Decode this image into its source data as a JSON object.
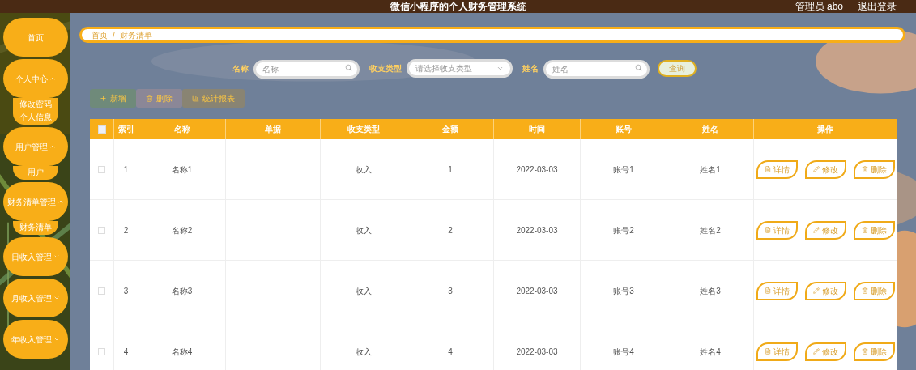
{
  "header": {
    "title": "微信小程序的个人财务管理系统",
    "user": "管理员 abo",
    "logout": "退出登录"
  },
  "sidebar": {
    "items": [
      {
        "label": "首页"
      },
      {
        "label": "个人中心",
        "expanded": true,
        "children": [
          {
            "label": "修改密码"
          },
          {
            "label": "个人信息"
          }
        ]
      },
      {
        "label": "用户管理",
        "expanded": true,
        "children": [
          {
            "label": "用户"
          }
        ]
      },
      {
        "label": "财务清单管理",
        "expanded": true,
        "children": [
          {
            "label": "财务清单"
          }
        ]
      },
      {
        "label": "日收入管理",
        "expanded": false
      },
      {
        "label": "月收入管理",
        "expanded": false
      },
      {
        "label": "年收入管理",
        "expanded": false
      }
    ]
  },
  "breadcrumb": [
    "首页",
    "/",
    "财务清单"
  ],
  "search": [
    {
      "kind": "text",
      "label": "名称",
      "placeholder": "名称"
    },
    {
      "kind": "select",
      "label": "收支类型",
      "placeholder": "请选择收支类型"
    },
    {
      "kind": "text",
      "label": "姓名",
      "placeholder": "姓名"
    }
  ],
  "search_button": "查询",
  "toolbar": [
    {
      "kind": "add",
      "label": "新增"
    },
    {
      "kind": "delete",
      "label": "删除"
    },
    {
      "kind": "report",
      "label": "统计报表"
    }
  ],
  "table": {
    "columns": [
      "索引",
      "名称",
      "单据",
      "收支类型",
      "金额",
      "时间",
      "账号",
      "姓名",
      "操作"
    ],
    "header_checked": false,
    "rows": [
      {
        "checked": false,
        "cells": [
          "1",
          "名称1",
          "",
          "收入",
          "1",
          "2022-03-03",
          "账号1",
          "姓名1"
        ],
        "actions": [
          {
            "kind": "detail",
            "label": "详情"
          },
          {
            "kind": "edit",
            "label": "修改"
          },
          {
            "kind": "delete",
            "label": "删除"
          }
        ]
      },
      {
        "checked": false,
        "cells": [
          "2",
          "名称2",
          "",
          "收入",
          "2",
          "2022-03-03",
          "账号2",
          "姓名2"
        ],
        "actions": [
          {
            "kind": "detail",
            "label": "详情"
          },
          {
            "kind": "edit",
            "label": "修改"
          },
          {
            "kind": "delete",
            "label": "删除"
          }
        ]
      },
      {
        "checked": false,
        "cells": [
          "3",
          "名称3",
          "",
          "收入",
          "3",
          "2022-03-03",
          "账号3",
          "姓名3"
        ],
        "actions": [
          {
            "kind": "detail",
            "label": "详情"
          },
          {
            "kind": "edit",
            "label": "修改"
          },
          {
            "kind": "delete",
            "label": "删除"
          }
        ]
      },
      {
        "checked": false,
        "cells": [
          "4",
          "名称4",
          "",
          "收入",
          "4",
          "2022-03-03",
          "账号4",
          "姓名4"
        ],
        "actions": [
          {
            "kind": "detail",
            "label": "详情"
          },
          {
            "kind": "edit",
            "label": "修改"
          },
          {
            "kind": "delete",
            "label": "删除"
          }
        ]
      }
    ]
  }
}
